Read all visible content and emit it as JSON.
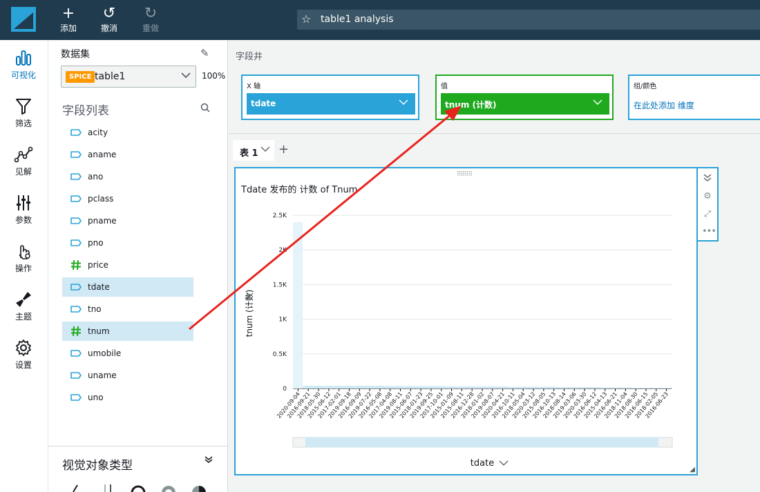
{
  "toolbar": {
    "add_label": "添加",
    "undo_label": "撤消",
    "redo_label": "重做",
    "analysis_title": "table1 analysis"
  },
  "nav": {
    "items": [
      {
        "label": "可视化",
        "icon": "visualize-icon"
      },
      {
        "label": "筛选",
        "icon": "filter-icon"
      },
      {
        "label": "见解",
        "icon": "insights-icon"
      },
      {
        "label": "参数",
        "icon": "parameters-icon"
      },
      {
        "label": "操作",
        "icon": "actions-icon"
      },
      {
        "label": "主题",
        "icon": "themes-icon"
      },
      {
        "label": "设置",
        "icon": "settings-icon"
      }
    ]
  },
  "dataset": {
    "label": "数据集",
    "badge": "SPICE",
    "name": "table1",
    "percent": "100%"
  },
  "fields": {
    "title": "字段列表",
    "items": [
      {
        "name": "acity",
        "type": "string"
      },
      {
        "name": "aname",
        "type": "string"
      },
      {
        "name": "ano",
        "type": "string"
      },
      {
        "name": "pclass",
        "type": "string"
      },
      {
        "name": "pname",
        "type": "string"
      },
      {
        "name": "pno",
        "type": "string"
      },
      {
        "name": "price",
        "type": "number"
      },
      {
        "name": "tdate",
        "type": "string",
        "selected": true
      },
      {
        "name": "tno",
        "type": "string"
      },
      {
        "name": "tnum",
        "type": "number",
        "selected": true
      },
      {
        "name": "umobile",
        "type": "string"
      },
      {
        "name": "uname",
        "type": "string"
      },
      {
        "name": "uno",
        "type": "string"
      }
    ]
  },
  "visual_types": {
    "title": "视觉对象类型"
  },
  "wells": {
    "label": "字段井",
    "x_axis": {
      "label": "X 轴",
      "value": "tdate"
    },
    "value": {
      "label": "值",
      "value": "tnum (计数)"
    },
    "group": {
      "label": "组/颜色",
      "placeholder": "在此处添加 维度"
    }
  },
  "sheet": {
    "tab_label": "表 1"
  },
  "colors": {
    "topbar": "#1f3b4d",
    "accent_blue": "#29a3d8",
    "value_green": "#1fa91f",
    "arrow_red": "#e8231d",
    "bar": "#cfe9f6"
  },
  "chart_data": {
    "type": "bar",
    "title": "Tdate 发布的 计数 of Tnum",
    "xlabel": "tdate",
    "ylabel": "tnum (计数)",
    "ylim": [
      0,
      2500
    ],
    "yticks": [
      "0",
      "0.5K",
      "1K",
      "1.5K",
      "2K",
      "2.5K"
    ],
    "categories": [
      "2020-09-04",
      "2016-09-21",
      "2018-05-30",
      "2015-06-12",
      "2017-02-01",
      "2019-09-18",
      "2016-09-09",
      "2019-07-22",
      "2016-05-08",
      "2017-04-08",
      "2019-08-11",
      "2015-06-07",
      "2018-01-23",
      "2019-09-25",
      "2017-10-01",
      "2015-01-09",
      "2015-08-11",
      "2016-12-28",
      "2018-01-02",
      "2019-08-07",
      "2020-04-21",
      "2016-10-11",
      "2018-05-04",
      "2020-03-12",
      "2015-08-05",
      "2016-10-13",
      "2018-08-14",
      "2019-03-06",
      "2020-03-30",
      "2016-06-12",
      "2015-04-13",
      "2016-06-21",
      "2018-11-04",
      "2018-08-30",
      "2016-06-15",
      "2018-02-05",
      "2016-06-23"
    ],
    "values": [
      2400,
      40,
      40,
      40,
      40,
      40,
      40,
      40,
      40,
      35,
      35,
      35,
      35,
      35,
      35,
      30,
      30,
      30,
      30,
      30,
      30,
      25,
      25,
      25,
      25,
      25,
      20,
      20,
      20,
      20,
      15,
      15,
      15,
      10,
      10,
      10,
      10
    ]
  }
}
